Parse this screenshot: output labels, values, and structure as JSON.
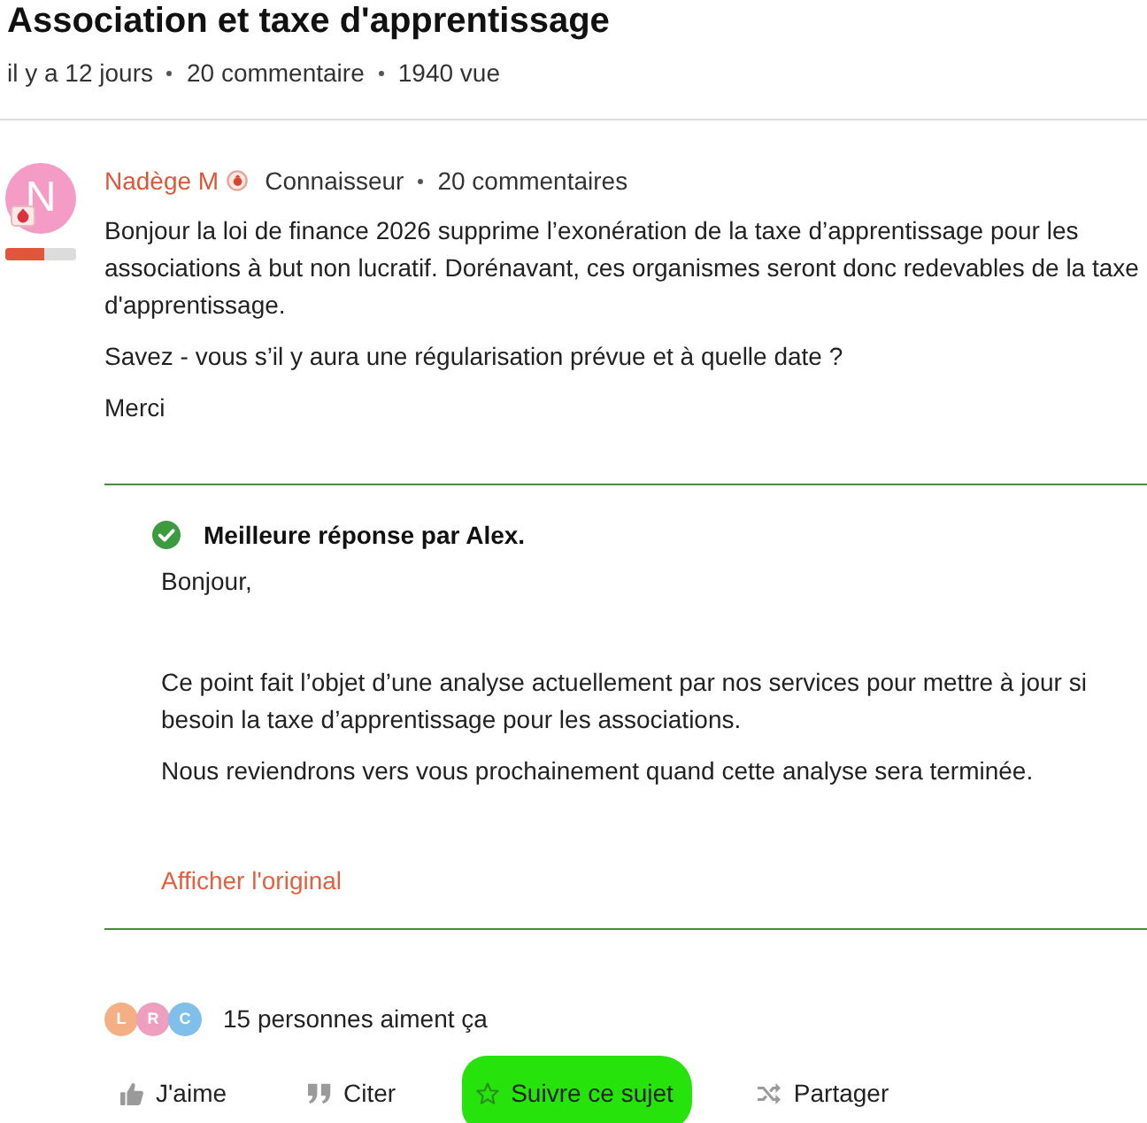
{
  "header": {
    "title": "Association et taxe d'apprentissage",
    "meta": [
      "il y a 12 jours",
      "20 commentaire",
      "1940 vue"
    ]
  },
  "post": {
    "author": {
      "avatar_letter": "N",
      "name": "Nadège M",
      "rank": "Connaisseur",
      "comments": "20 commentaires",
      "level": 0.55
    },
    "paragraphs": [
      "Bonjour la loi de finance 2026 supprime l’exonération de la taxe d’apprentissage pour les associations à but non lucratif. Dorénavant, ces organismes seront donc redevables de la taxe d'apprentissage.",
      "Savez - vous s’il y aura une régularisation prévue et à quelle date ?",
      "Merci"
    ]
  },
  "best_answer": {
    "label": "Meilleure réponse par Alex.",
    "greeting": "Bonjour,",
    "paragraphs": [
      "Ce point fait l’objet d’une analyse actuellement par nos services pour mettre à jour si besoin la taxe d’apprentissage pour les associations.",
      "Nous reviendrons vers vous prochainement quand cette analyse sera terminée."
    ],
    "link": "Afficher l'original"
  },
  "likes": {
    "avatars": [
      {
        "letter": "L",
        "color": "#f4b084"
      },
      {
        "letter": "R",
        "color": "#ee9fc0"
      },
      {
        "letter": "C",
        "color": "#7fbfea"
      }
    ],
    "text": "15 personnes aiment ça"
  },
  "actions": [
    {
      "kind": "like",
      "label": "J'aime",
      "highlighted": false
    },
    {
      "kind": "quote",
      "label": "Citer",
      "highlighted": false
    },
    {
      "kind": "star",
      "label": "Suivre ce sujet",
      "highlighted": true
    },
    {
      "kind": "share",
      "label": "Partager",
      "highlighted": false
    }
  ]
}
